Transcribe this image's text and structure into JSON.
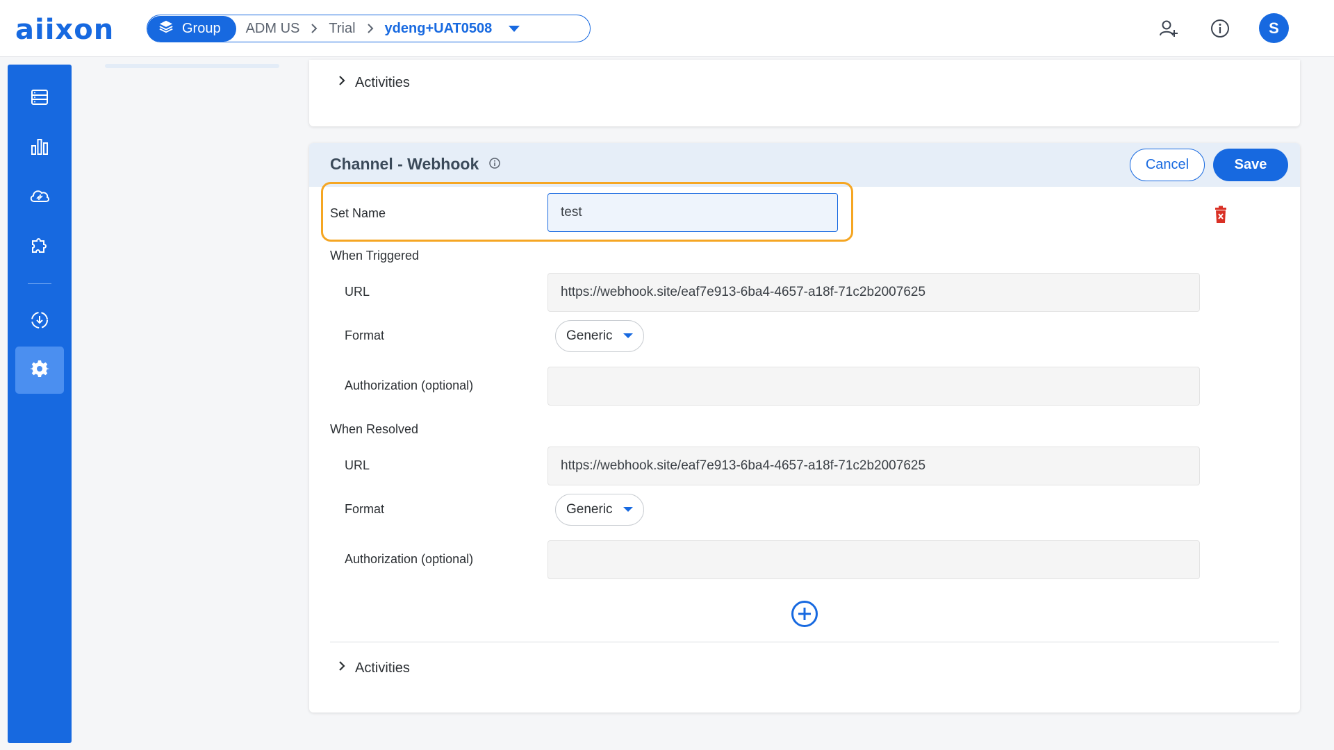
{
  "app": {
    "logo_text": "aiixon"
  },
  "breadcrumb": {
    "group_label": "Group",
    "items": [
      "ADM US",
      "Trial",
      "ydeng+UAT0508"
    ]
  },
  "header": {
    "avatar_initial": "S"
  },
  "sidebar": {
    "items": [
      "devices-icon",
      "analytics-icon",
      "cloud-sync-icon",
      "plugin-icon",
      "deploy-icon",
      "settings-icon"
    ],
    "active": "settings-icon"
  },
  "top_card": {
    "activities_label": "Activities"
  },
  "channel": {
    "title": "Channel - Webhook",
    "cancel_label": "Cancel",
    "save_label": "Save",
    "set_name_label": "Set Name",
    "set_name_value": "test",
    "when_triggered": {
      "heading": "When Triggered",
      "url_label": "URL",
      "url_value": "https://webhook.site/eaf7e913-6ba4-4657-a18f-71c2b2007625",
      "format_label": "Format",
      "format_value": "Generic",
      "auth_label": "Authorization (optional)",
      "auth_value": ""
    },
    "when_resolved": {
      "heading": "When Resolved",
      "url_label": "URL",
      "url_value": "https://webhook.site/eaf7e913-6ba4-4657-a18f-71c2b2007625",
      "format_label": "Format",
      "format_value": "Generic",
      "auth_label": "Authorization (optional)",
      "auth_value": ""
    },
    "activities_label": "Activities"
  },
  "colors": {
    "accent": "#1769e0",
    "highlight": "#f5a623",
    "danger": "#d93025"
  }
}
